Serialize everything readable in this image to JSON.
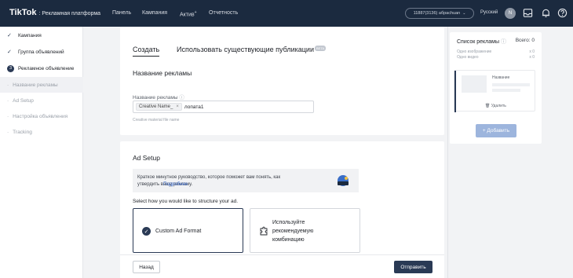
{
  "topbar": {
    "logo": "TikTok",
    "platform": ": Рекламная платформа",
    "nav": [
      {
        "label": "Панель"
      },
      {
        "label": "Кампания"
      },
      {
        "label": "Актив",
        "sup": "+"
      },
      {
        "label": "Отчетность"
      }
    ],
    "account": "11887(3136) абрасhuan",
    "language": "Русский",
    "avatar_letter": "N",
    "icons": [
      "inbox-icon",
      "bell-icon",
      "help-icon"
    ]
  },
  "sidebar": {
    "steps": [
      {
        "label": "Кампания",
        "done": true
      },
      {
        "label": "Группа объявлений",
        "done": true
      },
      {
        "label": "Рекламное объявление",
        "number": "3"
      }
    ],
    "sub_items": [
      {
        "label": "Название рекламы",
        "active": true
      },
      {
        "label": "Ad Setup"
      },
      {
        "label": "Настройка объявления"
      },
      {
        "label": "Tracking"
      }
    ]
  },
  "tabs": [
    {
      "label": "Создать",
      "active": true
    },
    {
      "label": "Использовать существующие публикации",
      "badge": "BETA"
    }
  ],
  "ad_name": {
    "heading": "Название рекламы",
    "field_label": "Название рекламы",
    "chip": "Creative Name_",
    "value": "лопата1",
    "hint": "Creative material file name"
  },
  "ad_setup": {
    "heading": "Ad Setup",
    "tip_text": "Краткое минутное руководство, которое поможет вам понять, как утвердить вашу рекламу.",
    "tip_link": "Подробнее",
    "question": "Select how you would like to structure your ad.",
    "options": [
      {
        "label": "Custom Ad Format",
        "selected": true
      },
      {
        "label_lines": [
          "Используйте",
          "рекомендуемую",
          "комбинацию"
        ]
      }
    ]
  },
  "footer": {
    "back": "Назад",
    "submit": "Отправить"
  },
  "ad_list": {
    "title": "Список рекламы",
    "total": "Всего: 0",
    "rows": [
      {
        "label": "Одно изображение",
        "value": "x 0"
      },
      {
        "label": "Одно видео",
        "value": "x 0"
      }
    ],
    "item_name": "Название",
    "delete": "Удалить",
    "add": "+ Добавить"
  },
  "colors": {
    "topbar": "#1b2a3f",
    "accent": "#2a3a55",
    "add_button": "#9db5dd",
    "link": "#2d5fc4"
  }
}
